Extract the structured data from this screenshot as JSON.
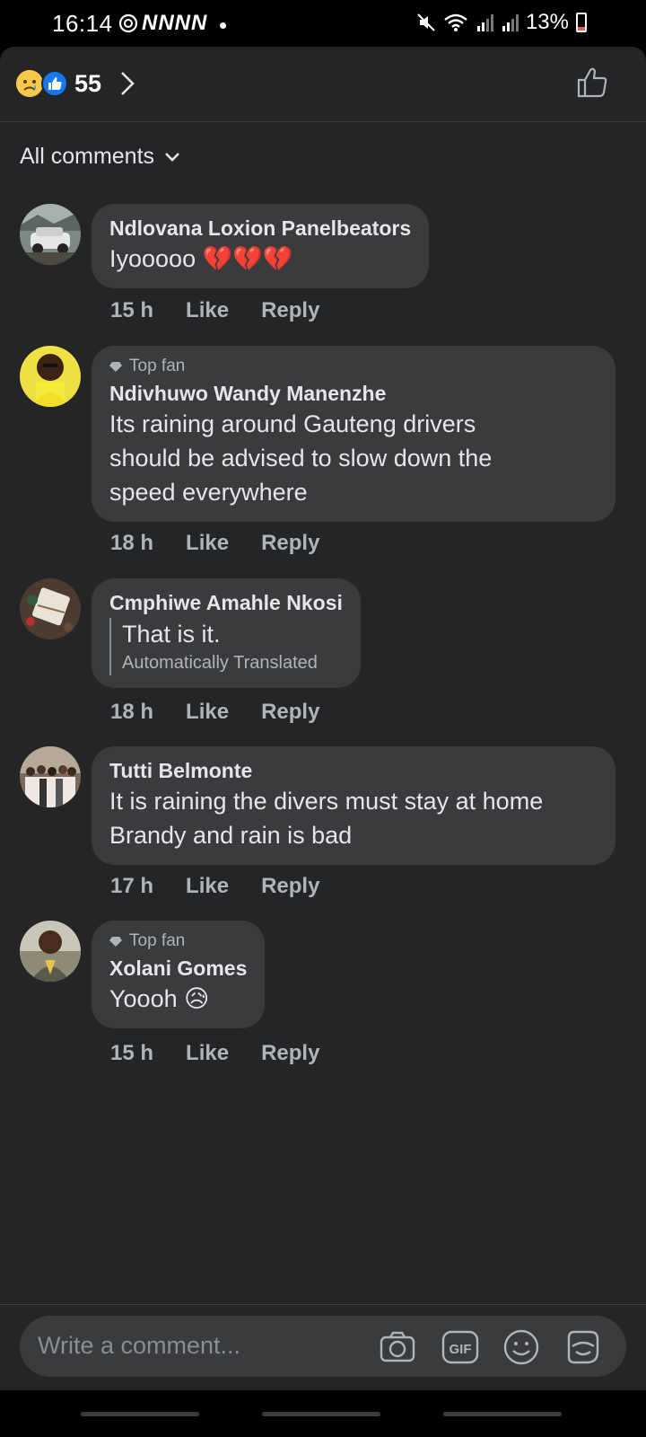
{
  "status_bar": {
    "time": "16:14",
    "left_symbols": "NNNN",
    "battery": "13%"
  },
  "reactions": {
    "count": "55"
  },
  "filter": {
    "label": "All comments"
  },
  "comments": [
    {
      "author": "Ndlovana Loxion Panelbeators",
      "text": "Iyooooo 💔💔💔",
      "time": "15 h",
      "like": "Like",
      "reply": "Reply"
    },
    {
      "badge": "Top fan",
      "author": "Ndivhuwo Wandy Manenzhe",
      "text_lines": [
        "Its raining around Gauteng  drivers",
        "should be advised  to slow down   the",
        "speed everywhere"
      ],
      "time": "18 h",
      "like": "Like",
      "reply": "Reply"
    },
    {
      "author": "Cmphiwe Amahle Nkosi",
      "text": "That is it.",
      "translated_label": "Automatically Translated",
      "time": "18 h",
      "like": "Like",
      "reply": "Reply"
    },
    {
      "author": "Tutti Belmonte",
      "text_lines": [
        "It is raining the divers must stay at home",
        "Brandy and rain is bad"
      ],
      "time": "17 h",
      "like": "Like",
      "reply": "Reply"
    },
    {
      "badge": "Top fan",
      "author": "Xolani Gomes",
      "text": "Yoooh 😥",
      "time": "15 h",
      "like": "Like",
      "reply": "Reply"
    }
  ],
  "composer": {
    "placeholder": "Write a comment..."
  },
  "colors": {
    "background": "#242526",
    "bubble": "#3a3b3c",
    "secondary_text": "#b0b3b8",
    "like_blue": "#1877f2"
  },
  "icons": [
    "sad-reaction-icon",
    "like-reaction-icon",
    "chevron-right-icon",
    "thumbs-up-icon",
    "chevron-down-icon",
    "diamond-icon",
    "camera-icon",
    "gif-icon",
    "emoji-icon",
    "sticker-icon"
  ]
}
